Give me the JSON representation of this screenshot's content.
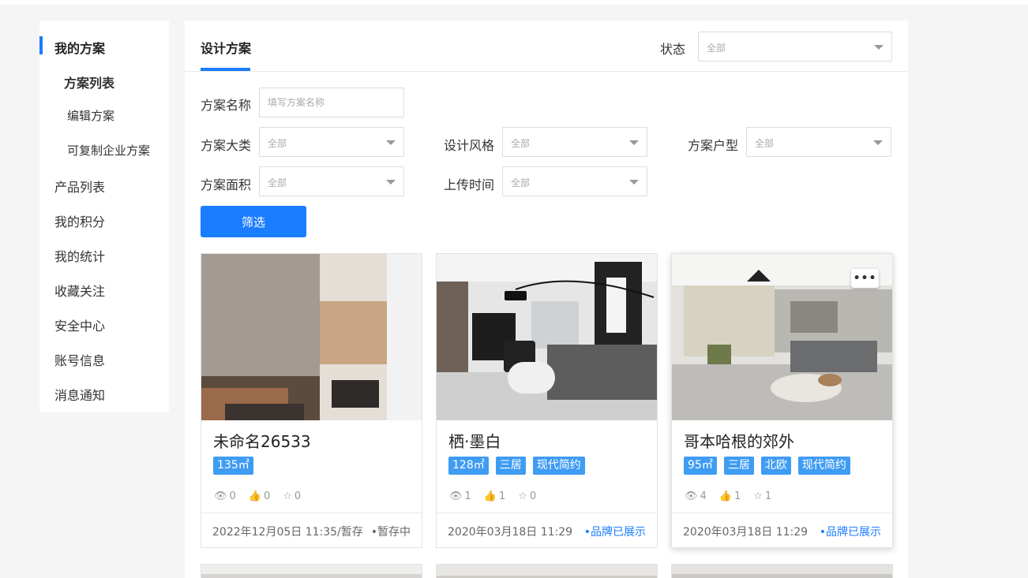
{
  "sidebar": {
    "items": [
      {
        "label": "我的方案"
      },
      {
        "label": "方案列表"
      },
      {
        "label": "编辑方案"
      },
      {
        "label": "可复制企业方案"
      },
      {
        "label": "产品列表"
      },
      {
        "label": "我的积分"
      },
      {
        "label": "我的统计"
      },
      {
        "label": "收藏关注"
      },
      {
        "label": "安全中心"
      },
      {
        "label": "账号信息"
      },
      {
        "label": "消息通知"
      }
    ],
    "accent": "#1a7cff"
  },
  "main": {
    "tab_title": "设计方案",
    "status_label": "状态",
    "status_value": "全部",
    "filters": {
      "name_label": "方案名称",
      "name_placeholder": "填写方案名称",
      "category_label": "方案大类",
      "category_value": "全部",
      "style_label": "设计风格",
      "style_value": "全部",
      "layout_label": "方案户型",
      "layout_value": "全部",
      "area_label": "方案面积",
      "area_value": "全部",
      "upload_label": "上传时间",
      "upload_value": "全部",
      "submit_label": "筛选"
    },
    "cards": [
      {
        "name": "未命名26533",
        "tags": [
          "135㎡"
        ],
        "views": "0",
        "likes": "0",
        "favs": "0",
        "date": "2022年12月05日 11:35/暂存",
        "status": "•暂存中"
      },
      {
        "name": "栖·墨白",
        "tags": [
          "128㎡",
          "三居",
          "现代简约"
        ],
        "views": "1",
        "likes": "1",
        "favs": "0",
        "date": "2020年03月18日 11:29",
        "status": "•品牌已展示"
      },
      {
        "name": "哥本哈根的郊外",
        "tags": [
          "95㎡",
          "三居",
          "北欧",
          "现代简约"
        ],
        "views": "4",
        "likes": "1",
        "favs": "1",
        "date": "2020年03月18日 11:29",
        "status": "•品牌已展示",
        "more": "•••"
      }
    ]
  }
}
